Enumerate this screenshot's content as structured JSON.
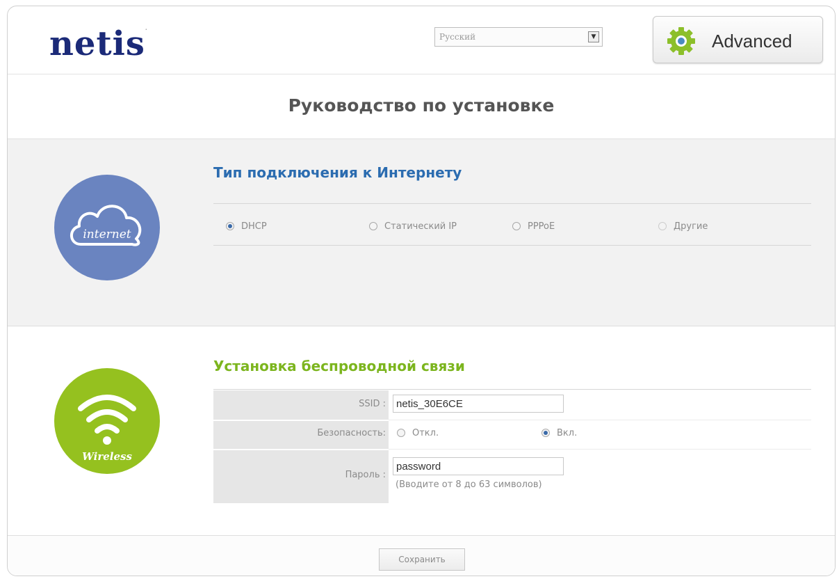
{
  "header": {
    "logo": "netis",
    "language": "Русский",
    "advanced_label": "Advanced"
  },
  "title": "Руководство по установке",
  "internet": {
    "icon_label": "internet",
    "section_title": "Тип подключения к Интернету",
    "options": [
      {
        "label": "DHCP",
        "selected": true
      },
      {
        "label": "Статический IP",
        "selected": false
      },
      {
        "label": "PPPoE",
        "selected": false
      },
      {
        "label": "Другие",
        "selected": false
      }
    ]
  },
  "wireless": {
    "icon_label": "Wireless",
    "section_title": "Установка беспроводной связи",
    "ssid_label": "SSID :",
    "ssid_value": "netis_30E6CE",
    "security_label": "Безопасность:",
    "security_off": "Откл.",
    "security_on": "Вкл.",
    "password_label": "Пароль :",
    "password_value": "password",
    "password_hint": "(Вводите от 8 до 63 символов)"
  },
  "footer": {
    "save_label": "Сохранить"
  },
  "colors": {
    "logo": "#1b2a78",
    "internet_blue": "#6a84c0",
    "wireless_green": "#95c11f",
    "internet_title": "#2b6cb0",
    "wireless_title": "#7cb51e"
  }
}
